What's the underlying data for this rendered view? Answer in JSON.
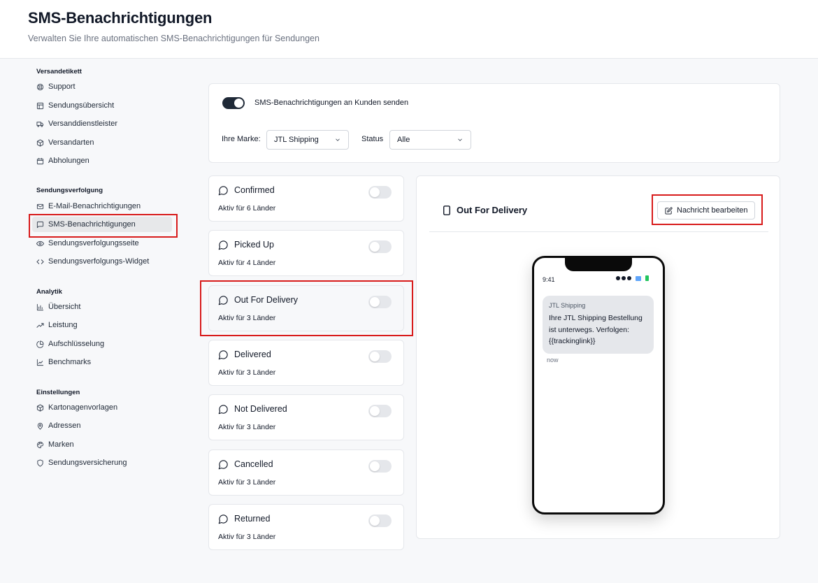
{
  "header": {
    "title": "SMS-Benachrichtigungen",
    "subtitle": "Verwalten Sie Ihre automatischen SMS-Benachrichtigungen für Sendungen"
  },
  "sidebar": {
    "sections": [
      {
        "title": "Versandetikett",
        "items": [
          {
            "label": "Support",
            "icon": "support-icon"
          },
          {
            "label": "Sendungsübersicht",
            "icon": "layout-icon"
          },
          {
            "label": "Versanddienstleister",
            "icon": "truck-icon"
          },
          {
            "label": "Versandarten",
            "icon": "package-icon"
          },
          {
            "label": "Abholungen",
            "icon": "calendar-icon"
          }
        ]
      },
      {
        "title": "Sendungsverfolgung",
        "items": [
          {
            "label": "E-Mail-Benachrichtigungen",
            "icon": "mail-icon"
          },
          {
            "label": "SMS-Benachrichtigungen",
            "icon": "message-icon",
            "active": true
          },
          {
            "label": "Sendungsverfolgungsseite",
            "icon": "eye-icon"
          },
          {
            "label": "Sendungsverfolgungs-Widget",
            "icon": "code-icon"
          }
        ]
      },
      {
        "title": "Analytik",
        "items": [
          {
            "label": "Übersicht",
            "icon": "bar-chart-icon"
          },
          {
            "label": "Leistung",
            "icon": "trending-up-icon"
          },
          {
            "label": "Aufschlüsselung",
            "icon": "pie-chart-icon"
          },
          {
            "label": "Benchmarks",
            "icon": "line-chart-icon"
          }
        ]
      },
      {
        "title": "Einstellungen",
        "items": [
          {
            "label": "Kartonagenvorlagen",
            "icon": "box-icon"
          },
          {
            "label": "Adressen",
            "icon": "map-pin-icon"
          },
          {
            "label": "Marken",
            "icon": "palette-icon"
          },
          {
            "label": "Sendungsversicherung",
            "icon": "shield-icon"
          }
        ]
      }
    ]
  },
  "settings": {
    "toggle_label": "SMS-Benachrichtigungen an Kunden senden",
    "toggle_on": true,
    "brand_label": "Ihre Marke:",
    "brand_value": "JTL Shipping",
    "status_label": "Status",
    "status_value": "Alle"
  },
  "notifications": [
    {
      "title": "Confirmed",
      "subtitle": "Aktiv für 6 Länder",
      "enabled": false
    },
    {
      "title": "Picked Up",
      "subtitle": "Aktiv für 4 Länder",
      "enabled": false
    },
    {
      "title": "Out For Delivery",
      "subtitle": "Aktiv für 3 Länder",
      "enabled": false,
      "selected": true
    },
    {
      "title": "Delivered",
      "subtitle": "Aktiv für 3 Länder",
      "enabled": false
    },
    {
      "title": "Not Delivered",
      "subtitle": "Aktiv für 3 Länder",
      "enabled": false
    },
    {
      "title": "Cancelled",
      "subtitle": "Aktiv für 3 Länder",
      "enabled": false
    },
    {
      "title": "Returned",
      "subtitle": "Aktiv für 3 Länder",
      "enabled": false
    }
  ],
  "preview": {
    "title": "Out For Delivery",
    "edit_label": "Nachricht bearbeiten",
    "phone": {
      "time": "9:41",
      "sender": "JTL Shipping",
      "message": "Ihre JTL Shipping Bestellung ist unterwegs. Verfolgen: {{trackinglink}}",
      "timestamp": "now"
    }
  },
  "colors": {
    "highlight": "#d81b1b",
    "toggle_on": "#1f2937",
    "toggle_off": "#e5e7eb"
  }
}
